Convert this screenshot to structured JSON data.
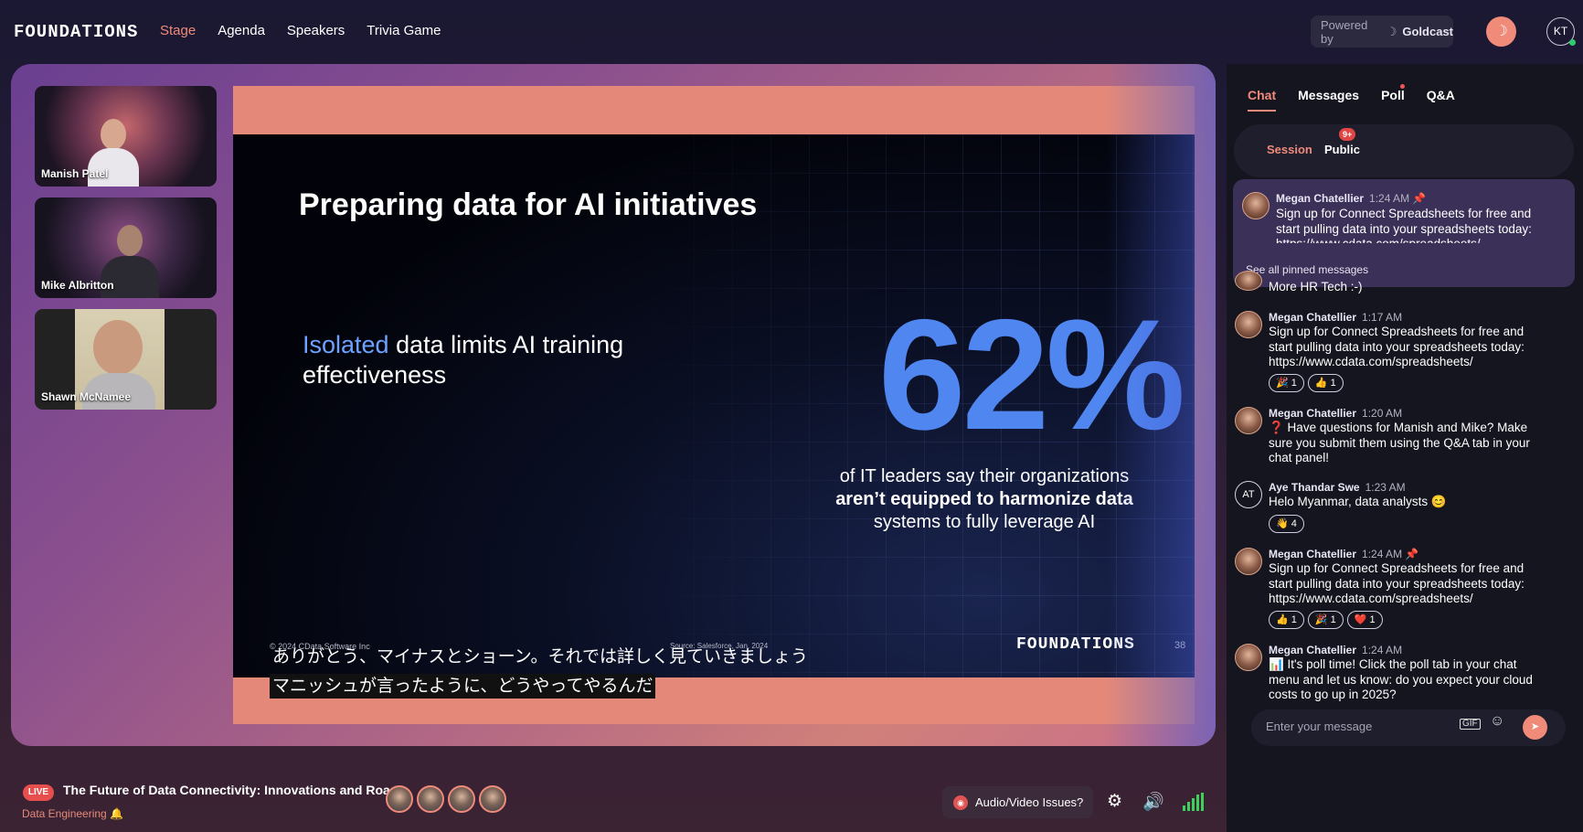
{
  "header": {
    "logo": "FOUNDATIONS",
    "nav": [
      "Stage",
      "Agenda",
      "Speakers",
      "Trivia Game"
    ],
    "powered_by": "Powered by",
    "powered_brand": "Goldcast",
    "user_initials": "KT"
  },
  "stage": {
    "speakers": [
      "Manish Patel",
      "Mike Albritton",
      "Shawn McNamee"
    ],
    "slide": {
      "title": "Preparing data for AI initiatives",
      "left_highlight": "Isolated",
      "left_rest": " data limits AI training effectiveness",
      "big_stat": "62%",
      "stat_line1": "of IT leaders say their organizations",
      "stat_line2": "aren’t equipped to harmonize data",
      "stat_line3": "systems to fully leverage AI",
      "copyright": "© 2024 CData Software Inc",
      "source": "Source: Salesforce, Jan. 2024",
      "logo": "FOUNDATIONS",
      "page_number": "38"
    },
    "captions": [
      "ありがとう、マイナスとショーン。それでは詳しく見ていきましょう",
      "マニッシュが言ったように、どうやってやるんだ"
    ]
  },
  "bottom_bar": {
    "live_badge": "LIVE",
    "session_title": "The Future of Data Connectivity: Innovations and Roa...",
    "track": "Data Engineering",
    "av_issues": "Audio/Video Issues?"
  },
  "chat_panel": {
    "tabs": [
      "Chat",
      "Messages",
      "Poll",
      "Q&A"
    ],
    "subtabs": [
      "Session",
      "Public"
    ],
    "public_badge": "9+",
    "pinned": {
      "author": "Megan Chatellier",
      "time": "1:24 AM",
      "text": "Sign up for Connect Spreadsheets for free and start pulling data into your spreadsheets today: https://www.cdata.com/spreadsheets/",
      "see_all": "See all pinned messages"
    },
    "partial_message": "More HR Tech :-)",
    "messages": [
      {
        "author": "Megan Chatellier",
        "time": "1:17 AM",
        "text": "Sign up for Connect Spreadsheets for free and start pulling data into your spreadsheets today: https://www.cdata.com/spreadsheets/",
        "reactions": [
          "🎉 1",
          "👍 1"
        ]
      },
      {
        "author": "Megan Chatellier",
        "time": "1:20 AM",
        "text": "❓ Have questions for Manish and Mike? Make sure you submit them using the Q&A tab in your chat panel!",
        "reactions": []
      },
      {
        "author": "Aye Thandar Swe",
        "initials": "AT",
        "time": "1:23 AM",
        "text": "Helo Myanmar, data analysts 😊",
        "reactions": [
          "👋 4"
        ]
      },
      {
        "author": "Megan Chatellier",
        "time": "1:24 AM",
        "text": "Sign up for Connect Spreadsheets for free and start pulling data into your spreadsheets today: https://www.cdata.com/spreadsheets/",
        "reactions": [
          "👍 1",
          "🎉 1",
          "❤️ 1"
        ]
      },
      {
        "author": "Megan Chatellier",
        "time": "1:24 AM",
        "text": "📊 It's poll time! Click the poll tab in your chat menu and let us know: do you expect your cloud costs to go up in 2025?",
        "reactions": []
      }
    ],
    "input_placeholder": "Enter your message"
  }
}
